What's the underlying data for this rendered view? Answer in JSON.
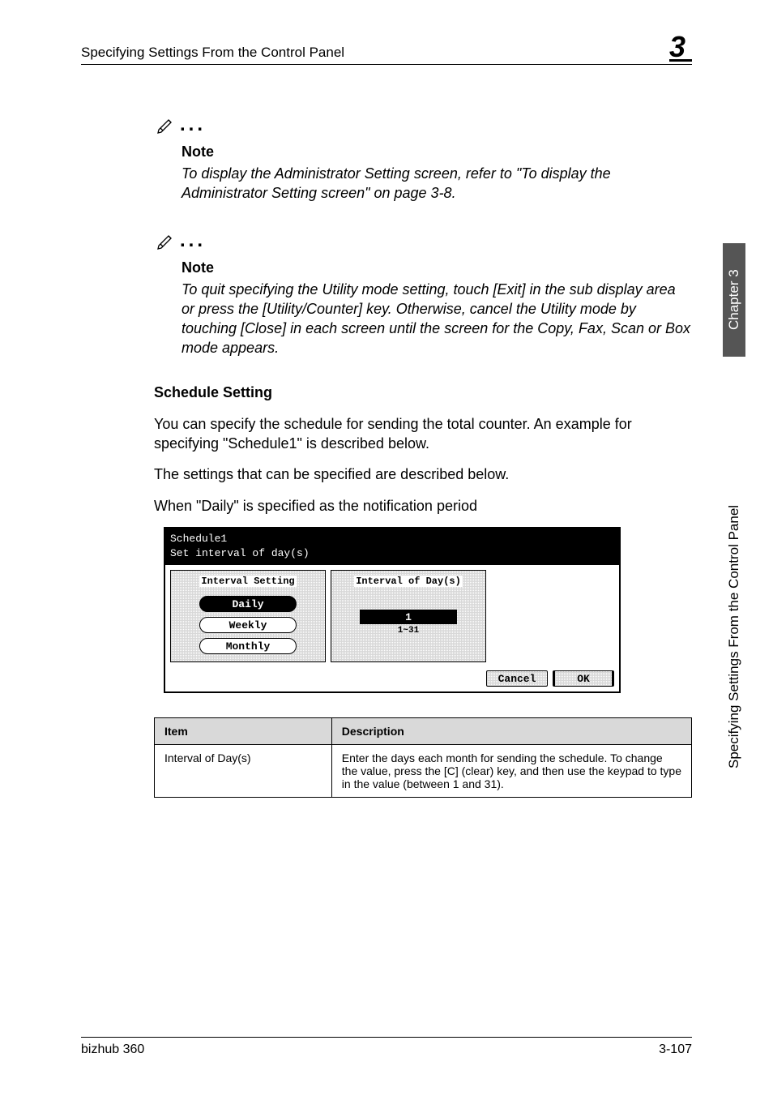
{
  "header": {
    "title": "Specifying Settings From the Control Panel",
    "chapter_num": "3"
  },
  "notes": [
    {
      "label": "Note",
      "body": "To display the Administrator Setting screen, refer to \"To display the Administrator Setting screen\" on page 3-8."
    },
    {
      "label": "Note",
      "body": "To quit specifying the Utility mode setting, touch [Exit] in the sub display area or press the [Utility/Counter] key. Otherwise, cancel the Utility mode by touching [Close] in each screen until the screen for the Copy, Fax, Scan or Box mode appears."
    }
  ],
  "section": {
    "heading": "Schedule Setting",
    "para1": "You can specify the schedule for sending the total counter. An example for specifying \"Schedule1\" is described below.",
    "para2": "The settings that can be specified are described below.",
    "para3": "When \"Daily\" is specified as the notification period"
  },
  "lcd": {
    "title1": "Schedule1",
    "title2": "Set interval of day(s)",
    "col1_title": "Interval Setting",
    "col2_title": "Interval of Day(s)",
    "buttons": {
      "daily": "Daily",
      "weekly": "Weekly",
      "monthly": "Monthly"
    },
    "value": "1",
    "range": "1~31",
    "cancel": "Cancel",
    "ok": "OK"
  },
  "table": {
    "head_item": "Item",
    "head_desc": "Description",
    "rows": [
      {
        "item": "Interval of Day(s)",
        "desc": "Enter the days each month for sending the schedule. To change the value, press the [C] (clear) key, and then use the keypad to type in the value (between 1 and 31)."
      }
    ]
  },
  "side": {
    "chapter": "Chapter 3",
    "title": "Specifying Settings From the Control Panel"
  },
  "footer": {
    "left": "bizhub 360",
    "right": "3-107"
  }
}
